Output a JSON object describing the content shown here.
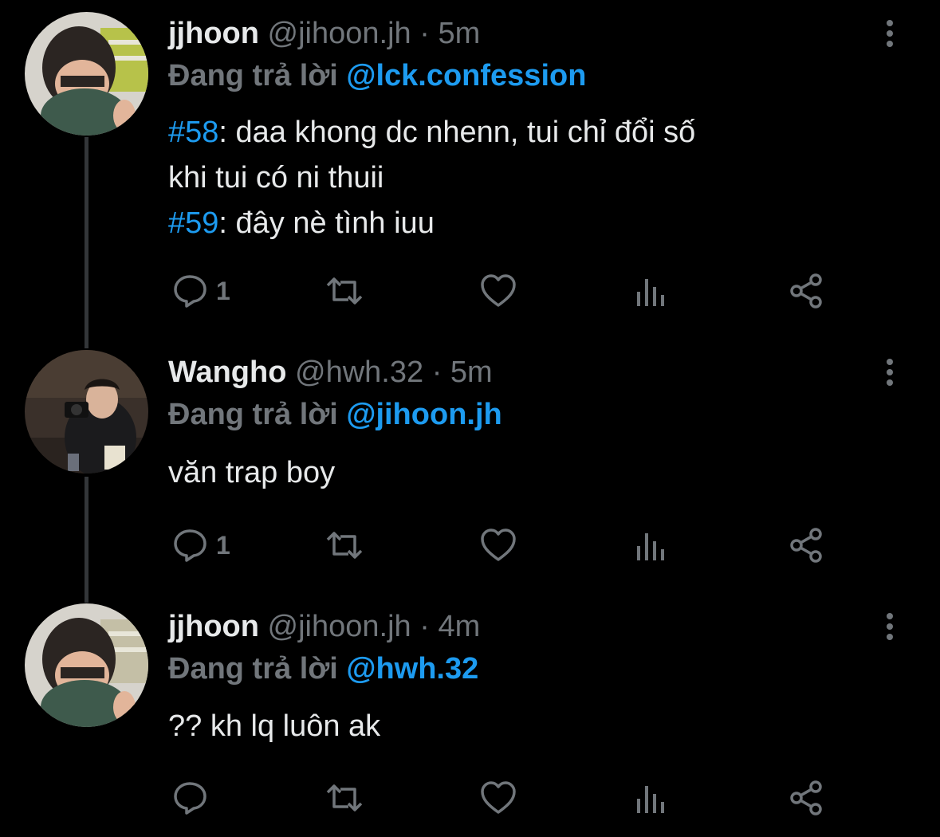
{
  "tweets": [
    {
      "display_name": "jjhoon",
      "handle": "@jihoon.jh",
      "separator": "·",
      "time": "5m",
      "reply_prefix": "Đang trả lời",
      "reply_to": "@lck.confession",
      "lines": [
        {
          "tag": "#58",
          "text": ": daa khong dc nhenn, tui chỉ đổi số"
        },
        {
          "tag": "",
          "text": "khi tui có ni thuii"
        },
        {
          "tag": "#59",
          "text": ": đây nè tình iuu"
        }
      ],
      "reply_count": "1"
    },
    {
      "display_name": "Wangho",
      "handle": "@hwh.32",
      "separator": "·",
      "time": "5m",
      "reply_prefix": "Đang trả lời",
      "reply_to": "@jihoon.jh",
      "lines": [
        {
          "tag": "",
          "text": "văn trap boy"
        }
      ],
      "reply_count": "1"
    },
    {
      "display_name": "jjhoon",
      "handle": "@jihoon.jh",
      "separator": "·",
      "time": "4m",
      "reply_prefix": "Đang trả lời",
      "reply_to": "@hwh.32",
      "lines": [
        {
          "tag": "",
          "text": "?? kh lq luôn ak"
        }
      ],
      "reply_count": ""
    }
  ],
  "icons": {
    "reply": "reply-icon",
    "retweet": "retweet-icon",
    "like": "heart-icon",
    "views": "analytics-icon",
    "share": "share-icon",
    "more": "more-icon"
  },
  "colors": {
    "background": "#000000",
    "text_primary": "#e7e9ea",
    "text_secondary": "#71767b",
    "accent": "#1d9bf0",
    "thread_line": "#333639"
  }
}
